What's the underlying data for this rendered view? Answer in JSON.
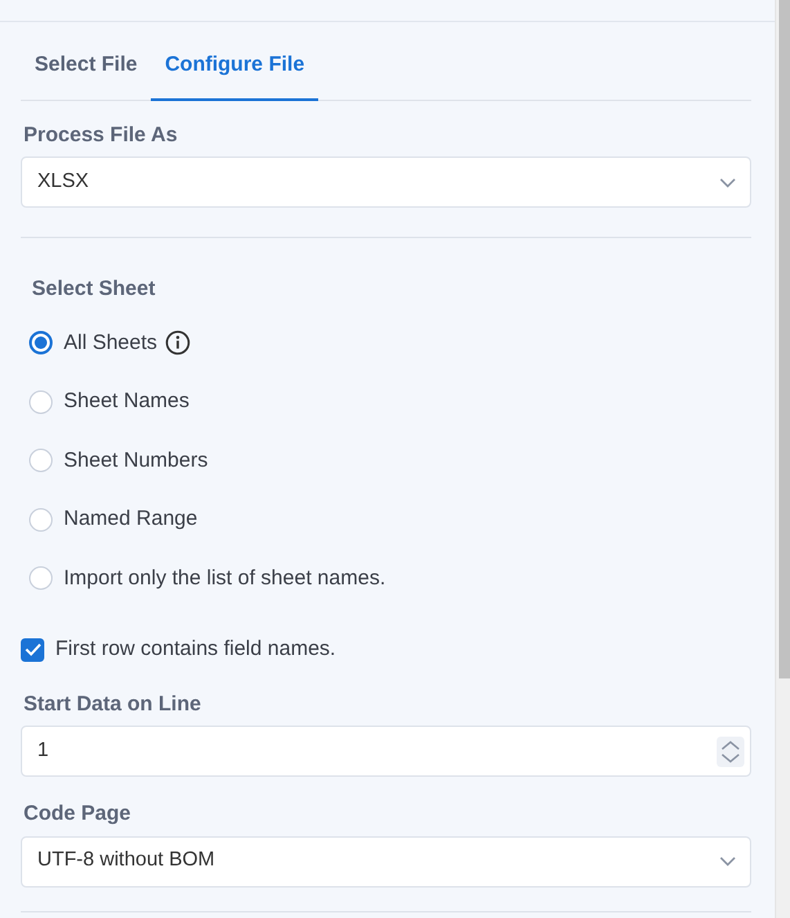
{
  "tabs": [
    {
      "label": "Select File",
      "selected": false
    },
    {
      "label": "Configure File",
      "selected": true
    }
  ],
  "process_file_as": {
    "label": "Process File As",
    "value": "XLSX"
  },
  "select_sheet": {
    "label": "Select Sheet",
    "options": [
      {
        "label": "All Sheets",
        "selected": true,
        "info": true
      },
      {
        "label": "Sheet Names",
        "selected": false,
        "info": false
      },
      {
        "label": "Sheet Numbers",
        "selected": false,
        "info": false
      },
      {
        "label": "Named Range",
        "selected": false,
        "info": false
      },
      {
        "label": "Import only the list of sheet names.",
        "selected": false,
        "info": false
      }
    ]
  },
  "first_row_field_names": {
    "label": "First row contains field names.",
    "checked": true
  },
  "start_data_on_line": {
    "label": "Start Data on Line",
    "value": "1"
  },
  "code_page": {
    "label": "Code Page",
    "value": "UTF-8 without BOM"
  }
}
